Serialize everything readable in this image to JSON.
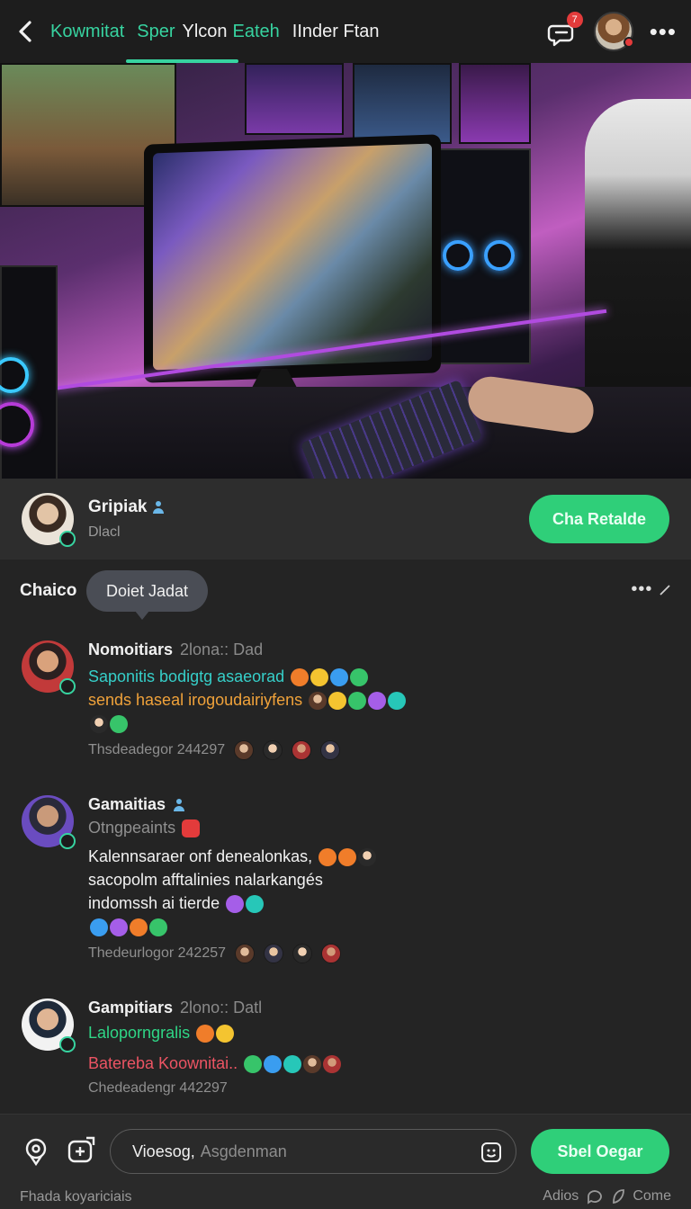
{
  "topbar": {
    "tabs": [
      {
        "label": "Kowmitat",
        "color": "#37d3a0"
      },
      {
        "label": "Sper",
        "color": "#37d3a0"
      },
      {
        "label": "Ylcon",
        "color": "#f1f1f1"
      },
      {
        "label": "Eateh",
        "color": "#37d3a0"
      },
      {
        "label": "IInder Ftan",
        "color": "#f1f1f1"
      }
    ],
    "notification_count": "7",
    "more_label": "•••"
  },
  "profile": {
    "name": "Gripiak",
    "subtitle": "Dlacl",
    "action_label": "Cha Retalde"
  },
  "chat": {
    "title": "Chaico",
    "tooltip": "Doiet Jadat",
    "options_label": "•••"
  },
  "messages": [
    {
      "user": "Nomoitiars",
      "time": "2lona:: Dad",
      "lines": [
        {
          "text": "Saponitis bodigtg asaeorad",
          "color": "#36cfc9"
        },
        {
          "text": "sends haseal irogoudairiyfens",
          "color": "#f0a23a"
        }
      ],
      "footer": "Thsdeadegor 244297"
    },
    {
      "user": "Gamaitias",
      "time": "Otngpeaints",
      "lines": [
        {
          "text": "Kalennsaraer onf denealonkas,",
          "color": "#f2f2f2"
        },
        {
          "text": "sacopolm afftalinies nalarkangés",
          "color": "#f2f2f2"
        },
        {
          "text": "indomssh ai tierde",
          "color": "#f2f2f2"
        }
      ],
      "footer": "Thedeurlogor 242257"
    },
    {
      "user": "Gampitiars",
      "time": "2lono:: Datl",
      "lines": [
        {
          "text": "Laloporngralis",
          "color": "#2fd686"
        },
        {
          "text": "Batereba Koownitai..",
          "color": "#ec5463"
        }
      ],
      "footer": "Chedeadengr 442297"
    }
  ],
  "composer": {
    "value": "Vioesog,",
    "placeholder": "Asgdenman",
    "send_label": "Sbel Oegar",
    "status_left": "Fhada koyariciais",
    "status_right_a": "Adios",
    "status_right_b": "Come"
  },
  "icons": {
    "back": "chevron-left-icon",
    "notification": "chat-bell-icon",
    "location": "location-pin-icon",
    "attach": "attach-square-icon",
    "emoji": "smiley-icon",
    "verified": "verified-badge-icon"
  }
}
